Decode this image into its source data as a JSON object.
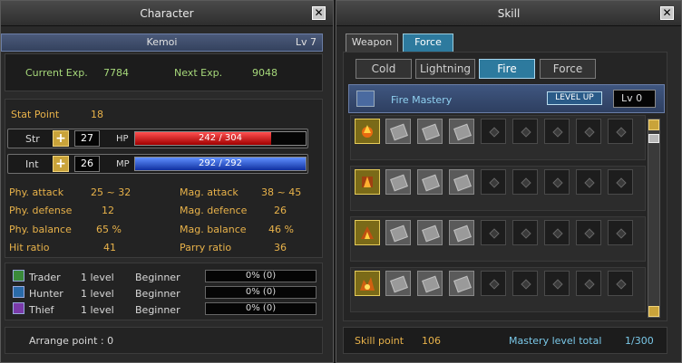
{
  "character": {
    "title": "Character",
    "name": "Kemoi",
    "level": "Lv 7",
    "current_exp_label": "Current Exp.",
    "current_exp": "7784",
    "next_exp_label": "Next Exp.",
    "next_exp": "9048",
    "stat_point_label": "Stat Point",
    "stat_point": "18",
    "str_label": "Str",
    "str_value": "27",
    "int_label": "Int",
    "int_value": "26",
    "hp_label": "HP",
    "hp_text": "242 / 304",
    "hp_fraction": 0.796,
    "mp_label": "MP",
    "mp_text": "292 / 292",
    "mp_fraction": 1.0,
    "stats": [
      {
        "label": "Phy. attack",
        "value": "25 ~ 32",
        "label2": "Mag. attack",
        "value2": "38 ~ 45"
      },
      {
        "label": "Phy. defense",
        "value": "12",
        "label2": "Mag. defence",
        "value2": "26"
      },
      {
        "label": "Phy. balance",
        "value": "65 %",
        "label2": "Mag. balance",
        "value2": "46 %"
      },
      {
        "label": "Hit ratio",
        "value": "41",
        "label2": "Parry ratio",
        "value2": "36"
      }
    ],
    "jobs": [
      {
        "name": "Trader",
        "level": "1 level",
        "rank": "Beginner",
        "progress": "0% (0)",
        "icon": "trader-icon",
        "color": "#3a8a3a"
      },
      {
        "name": "Hunter",
        "level": "1 level",
        "rank": "Beginner",
        "progress": "0% (0)",
        "icon": "hunter-icon",
        "color": "#2a6aa8"
      },
      {
        "name": "Thief",
        "level": "1 level",
        "rank": "Beginner",
        "progress": "0% (0)",
        "icon": "thief-icon",
        "color": "#7a3aa8"
      }
    ],
    "arrange_point": "Arrange point : 0"
  },
  "skill": {
    "title": "Skill",
    "tabs": [
      "Weapon",
      "Force"
    ],
    "active_tab": "Force",
    "subtabs": [
      "Cold",
      "Lightning",
      "Fire",
      "Force"
    ],
    "active_subtab": "Fire",
    "mastery_name": "Fire Mastery",
    "level_up_label": "LEVEL UP",
    "mastery_level": "Lv 0",
    "skill_point_label": "Skill point",
    "skill_point": "106",
    "mastery_total_label": "Mastery level total",
    "mastery_total": "1/300"
  },
  "colors": {
    "hp": "#c01818",
    "mp": "#2050c8",
    "accent": "#2d7a9e",
    "label_orange": "#e8b24a",
    "label_green": "#a6d87a"
  }
}
